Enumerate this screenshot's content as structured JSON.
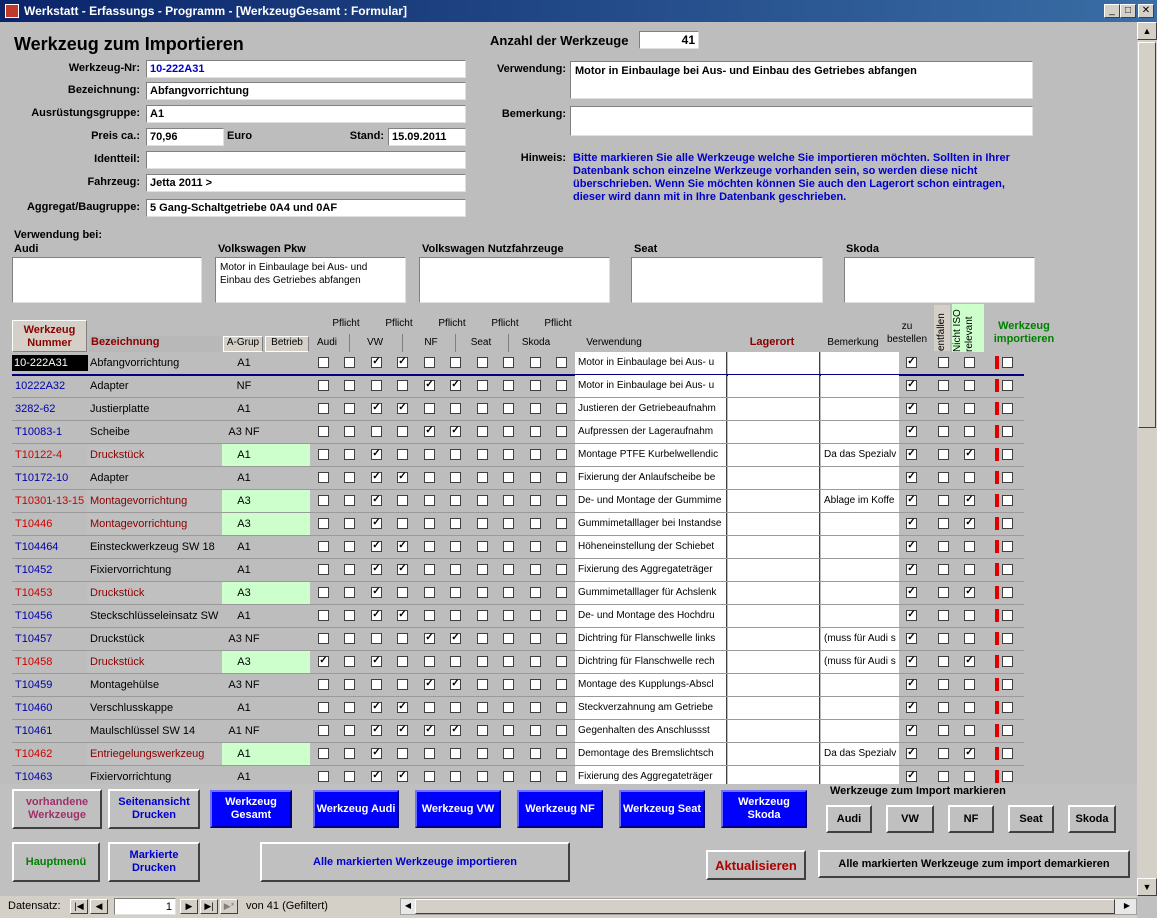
{
  "window": {
    "title": "Werkstatt - Erfassungs - Programm - [WerkzeugGesamt : Formular]",
    "btn_min": "_",
    "btn_max": "□",
    "btn_close": "✕"
  },
  "header": {
    "title": "Werkzeug zum Importieren",
    "count_label": "Anzahl der Werkzeuge",
    "count_value": "41",
    "werkzeug_nr_label": "Werkzeug-Nr:",
    "werkzeug_nr": "10-222A31",
    "bezeichnung_label": "Bezeichnung:",
    "bezeichnung": "Abfangvorrichtung",
    "ausruestung_label": "Ausrüstungsgruppe:",
    "ausruestung": "A1",
    "preis_label": "Preis ca.:",
    "preis": "70,96",
    "euro": "Euro",
    "stand_label": "Stand:",
    "stand": "15.09.2011",
    "identteil_label": "Identteil:",
    "identteil": "",
    "fahrzeug_label": "Fahrzeug:",
    "fahrzeug": "Jetta 2011 >",
    "aggregat_label": "Aggregat/Baugruppe:",
    "aggregat": "5 Gang-Schaltgetriebe 0A4 und 0AF",
    "verwendung_label": "Verwendung:",
    "verwendung": "Motor in Einbaulage bei Aus- und Einbau des Getriebes abfangen",
    "bemerkung_label": "Bemerkung:",
    "bemerkung": "",
    "hinweis_label": "Hinweis:",
    "hinweis": "Bitte markieren Sie alle Werkzeuge welche Sie importieren möchten. Sollten in Ihrer Datenbank schon einzelne Werkzeuge vorhanden sein, so werden diese nicht überschrieben. Wenn Sie möchten können Sie auch den Lagerort schon eintragen, dieser wird dann mit in Ihre Datenbank geschrieben."
  },
  "verwendung_bei": {
    "label": "Verwendung bei:",
    "audi_label": "Audi",
    "audi": "",
    "vw_label": "Volkswagen Pkw",
    "vw": "Motor in Einbaulage bei Aus- und Einbau des Getriebes abfangen",
    "nfz_label": "Volkswagen Nutzfahrzeuge",
    "nfz": "",
    "seat_label": "Seat",
    "seat": "",
    "skoda_label": "Skoda",
    "skoda": ""
  },
  "columns": {
    "nummer": "Werkzeug Nummer",
    "bezeichnung": "Bezeichnung",
    "agrup": "A-Grup",
    "betrieb": "Betrieb",
    "pflicht": "Pflicht",
    "audi": "Audi",
    "vw": "VW",
    "nf": "NF",
    "seat": "Seat",
    "skoda": "Skoda",
    "verwendung": "Verwendung",
    "lagerort": "Lagerort",
    "bemerkung": "Bemerkung",
    "zu_bestellen": "zu bestellen",
    "entfallen": "entfallen",
    "nicht_iso": "Nicht ISO relevant",
    "importieren": "Werkzeug importieren"
  },
  "rows": [
    {
      "nr": "10-222A31",
      "bez": "Abfangvorrichtung",
      "grp": "A1",
      "red": false,
      "cb": [
        0,
        0,
        1,
        1,
        0,
        0,
        0,
        0,
        0,
        0
      ],
      "verw": "Motor in Einbaulage bei Aus- u",
      "bem": "",
      "zb": 1,
      "ent": 0,
      "iso": 0
    },
    {
      "nr": "10222A32",
      "bez": "Adapter",
      "grp": "NF",
      "red": false,
      "cb": [
        0,
        0,
        0,
        0,
        1,
        1,
        0,
        0,
        0,
        0
      ],
      "verw": "Motor in Einbaulage bei Aus- u",
      "bem": "",
      "zb": 1,
      "ent": 0,
      "iso": 0
    },
    {
      "nr": "3282-62",
      "bez": "Justierplatte",
      "grp": "A1",
      "red": false,
      "cb": [
        0,
        0,
        1,
        1,
        0,
        0,
        0,
        0,
        0,
        0
      ],
      "verw": "Justieren der Getriebeaufnahm",
      "bem": "",
      "zb": 1,
      "ent": 0,
      "iso": 0
    },
    {
      "nr": "T10083-1",
      "bez": "Scheibe",
      "grp": "A3 NF",
      "red": false,
      "cb": [
        0,
        0,
        0,
        0,
        1,
        1,
        0,
        0,
        0,
        0
      ],
      "verw": "Aufpressen der Lageraufnahm",
      "bem": "",
      "zb": 1,
      "ent": 0,
      "iso": 0
    },
    {
      "nr": "T10122-4",
      "bez": "Druckstück",
      "grp": "A1",
      "red": true,
      "cb": [
        0,
        0,
        1,
        0,
        0,
        0,
        0,
        0,
        0,
        0
      ],
      "verw": "Montage PTFE Kurbelwellendic",
      "bem": "Da das Spezialv",
      "zb": 1,
      "ent": 0,
      "iso": 1
    },
    {
      "nr": "T10172-10",
      "bez": "Adapter",
      "grp": "A1",
      "red": false,
      "cb": [
        0,
        0,
        1,
        1,
        0,
        0,
        0,
        0,
        0,
        0
      ],
      "verw": "Fixierung der Anlaufscheibe be",
      "bem": "",
      "zb": 1,
      "ent": 0,
      "iso": 0
    },
    {
      "nr": "T10301-13-15",
      "bez": "Montagevorrichtung",
      "grp": "A3",
      "red": true,
      "cb": [
        0,
        0,
        1,
        0,
        0,
        0,
        0,
        0,
        0,
        0
      ],
      "verw": "De- und Montage der Gummime",
      "bem": "Ablage im Koffe",
      "zb": 1,
      "ent": 0,
      "iso": 1
    },
    {
      "nr": "T10446",
      "bez": "Montagevorrichtung",
      "grp": "A3",
      "red": true,
      "cb": [
        0,
        0,
        1,
        0,
        0,
        0,
        0,
        0,
        0,
        0
      ],
      "verw": "Gummimetalllager bei Instandse",
      "bem": "",
      "zb": 1,
      "ent": 0,
      "iso": 1
    },
    {
      "nr": "T104464",
      "bez": "Einsteckwerkzeug SW 18",
      "grp": "A1",
      "red": false,
      "cb": [
        0,
        0,
        1,
        1,
        0,
        0,
        0,
        0,
        0,
        0
      ],
      "verw": "Höheneinstellung der Schiebet",
      "bem": "",
      "zb": 1,
      "ent": 0,
      "iso": 0
    },
    {
      "nr": "T10452",
      "bez": "Fixiervorrichtung",
      "grp": "A1",
      "red": false,
      "cb": [
        0,
        0,
        1,
        1,
        0,
        0,
        0,
        0,
        0,
        0
      ],
      "verw": "Fixierung des Aggregateträger",
      "bem": "",
      "zb": 1,
      "ent": 0,
      "iso": 0
    },
    {
      "nr": "T10453",
      "bez": "Druckstück",
      "grp": "A3",
      "red": true,
      "cb": [
        0,
        0,
        1,
        0,
        0,
        0,
        0,
        0,
        0,
        0
      ],
      "verw": "Gummimetalllager für Achslenk",
      "bem": "",
      "zb": 1,
      "ent": 0,
      "iso": 1
    },
    {
      "nr": "T10456",
      "bez": "Steckschlüsseleinsatz SW 1",
      "grp": "A1",
      "red": false,
      "cb": [
        0,
        0,
        1,
        1,
        0,
        0,
        0,
        0,
        0,
        0
      ],
      "verw": "De- und Montage des Hochdru",
      "bem": "",
      "zb": 1,
      "ent": 0,
      "iso": 0
    },
    {
      "nr": "T10457",
      "bez": "Druckstück",
      "grp": "A3 NF",
      "red": false,
      "cb": [
        0,
        0,
        0,
        0,
        1,
        1,
        0,
        0,
        0,
        0
      ],
      "verw": "Dichtring für Flanschwelle links",
      "bem": "(muss für Audi s",
      "zb": 1,
      "ent": 0,
      "iso": 0
    },
    {
      "nr": "T10458",
      "bez": "Druckstück",
      "grp": "A3",
      "red": true,
      "cb": [
        1,
        0,
        1,
        0,
        0,
        0,
        0,
        0,
        0,
        0
      ],
      "verw": "Dichtring für Flanschwelle rech",
      "bem": "(muss für Audi s",
      "zb": 1,
      "ent": 0,
      "iso": 1
    },
    {
      "nr": "T10459",
      "bez": "Montagehülse",
      "grp": "A3 NF",
      "red": false,
      "cb": [
        0,
        0,
        0,
        0,
        1,
        1,
        0,
        0,
        0,
        0
      ],
      "verw": "Montage des Kupplungs-Abscl",
      "bem": "",
      "zb": 1,
      "ent": 0,
      "iso": 0
    },
    {
      "nr": "T10460",
      "bez": "Verschlusskappe",
      "grp": "A1",
      "red": false,
      "cb": [
        0,
        0,
        1,
        1,
        0,
        0,
        0,
        0,
        0,
        0
      ],
      "verw": "Steckverzahnung am Getriebe",
      "bem": "",
      "zb": 1,
      "ent": 0,
      "iso": 0
    },
    {
      "nr": "T10461",
      "bez": "Maulschlüssel SW 14",
      "grp": "A1 NF",
      "red": false,
      "cb": [
        0,
        0,
        1,
        1,
        1,
        1,
        0,
        0,
        0,
        0
      ],
      "verw": "Gegenhalten des Anschlussst",
      "bem": "",
      "zb": 1,
      "ent": 0,
      "iso": 0
    },
    {
      "nr": "T10462",
      "bez": "Entriegelungswerkzeug",
      "grp": "A1",
      "red": true,
      "cb": [
        0,
        0,
        1,
        0,
        0,
        0,
        0,
        0,
        0,
        0
      ],
      "verw": "Demontage des Bremslichtsch",
      "bem": "Da das Spezialv",
      "zb": 1,
      "ent": 0,
      "iso": 1
    },
    {
      "nr": "T10463",
      "bez": "Fixiervorrichtung",
      "grp": "A1",
      "red": false,
      "cb": [
        0,
        0,
        1,
        1,
        0,
        0,
        0,
        0,
        0,
        0
      ],
      "verw": "Fixierung des Aggregateträger",
      "bem": "",
      "zb": 1,
      "ent": 0,
      "iso": 0
    }
  ],
  "buttons": {
    "vorhandene": "vorhandene Werkzeuge",
    "seitenansicht": "Seitenansicht Drucken",
    "gesamt": "Werkzeug Gesamt",
    "audi": "Werkzeug Audi",
    "vw": "Werkzeug VW",
    "nf": "Werkzeug NF",
    "seat": "Werkzeug Seat",
    "skoda": "Werkzeug Skoda",
    "import_markieren_label": "Werkzeuge zum Import markieren",
    "m_audi": "Audi",
    "m_vw": "VW",
    "m_nf": "NF",
    "m_seat": "Seat",
    "m_skoda": "Skoda",
    "hauptmenu": "Hauptmenü",
    "markierte_drucken": "Markierte Drucken",
    "alle_importieren": "Alle markierten Werkzeuge importieren",
    "aktualisieren": "Aktualisieren",
    "demarkieren": "Alle markierten Werkzeuge zum import demarkieren"
  },
  "status": {
    "label": "Datensatz:",
    "record": "1",
    "of": "von  41 (Gefiltert)"
  },
  "colors": {
    "title_blue": "#0a246a",
    "button_blue": "#0000ff",
    "red_text": "#cc0000",
    "maroon": "#8b0000",
    "green": "#008000"
  }
}
